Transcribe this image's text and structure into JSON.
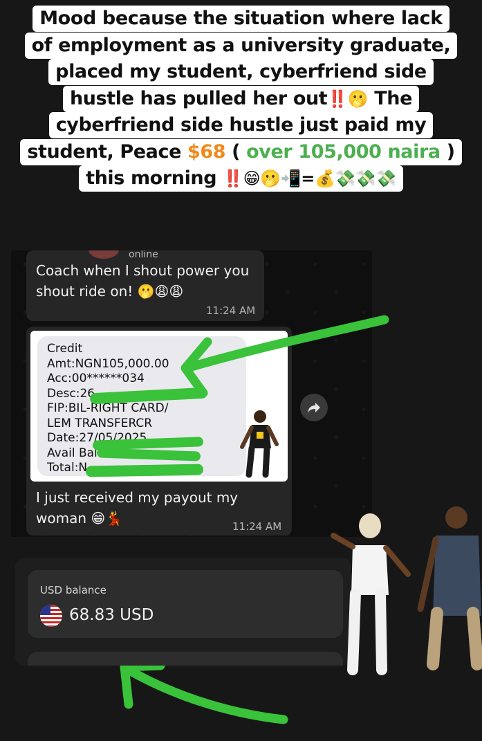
{
  "caption": {
    "line1": "Mood because the situation where lack",
    "line2": "of employment as a university graduate,",
    "line3": "placed my student,  cyberfriend side",
    "line4_a": "hustle has pulled her out",
    "line4_b": " The",
    "line5": "cyberfriend side hustle just paid my",
    "line6_a": "student, Peace ",
    "line6_amount": "$68",
    "line6_b": " ( ",
    "line6_naira": "over 105,000 naira",
    "line6_c": " )",
    "line7": "this morning ",
    "emoji_bangbang": "‼️",
    "emoji_line4": "🫢",
    "emoji_line7": "😁🫢📲=💰💸💸💸"
  },
  "chat": {
    "status": "online",
    "message1": {
      "line1": "Coach when I shout power you",
      "line2": "shout ride on! 🫢😩😩",
      "time": "11:24 AM"
    },
    "receipt": {
      "title": "Credit",
      "amt": "Amt:NGN105,000.00",
      "acc": "Acc:00******034",
      "desc": "Desc:26",
      "desc_end": "/",
      "fip1": "FIP:BIL-RIGHT CARD/",
      "fip2": "LEM TRANSFERCR",
      "date": "Date:27/05/2025",
      "avail": "Avail Bal:",
      "total": "Total:N"
    },
    "message2": {
      "line1": "I just received my payout my",
      "line2": "woman 😁💃",
      "time": "11:24 AM"
    }
  },
  "usd": {
    "label": "USD balance",
    "amount": "68.83 USD"
  },
  "colors": {
    "accent_green": "#39c23a",
    "amount_orange": "#f08a1a",
    "naira_green": "#4caf50"
  }
}
